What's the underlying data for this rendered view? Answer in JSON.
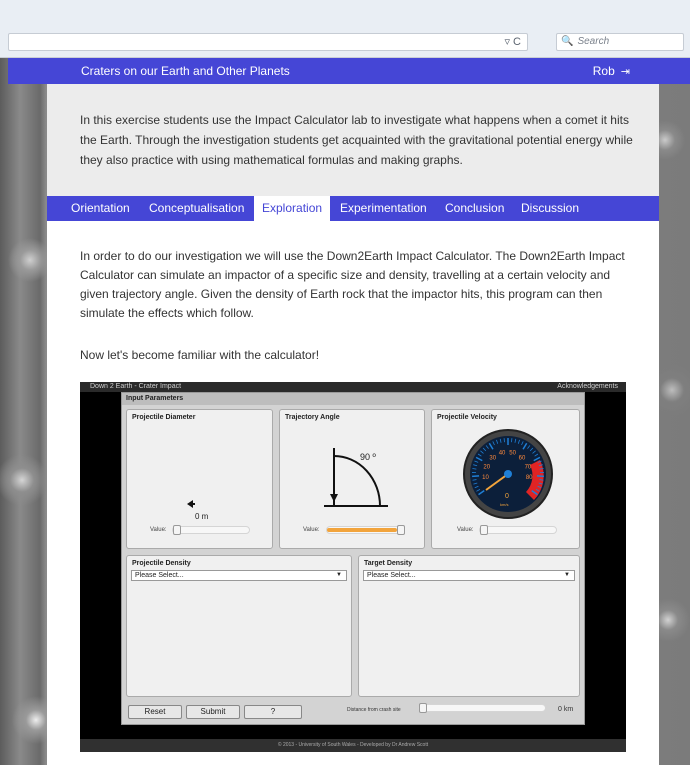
{
  "browser": {
    "search_placeholder": "Search"
  },
  "header": {
    "title": "Craters on our Earth and Other Planets",
    "user": "Rob",
    "logout_glyph": "⇥"
  },
  "intro": {
    "text": "In this exercise students use the Impact Calculator lab to investigate what happens when a comet it hits the Earth. Through the investigation students get acquainted with the gravitational potential energy while they also practice with using mathematical formulas and making graphs."
  },
  "tabs": [
    "Orientation",
    "Conceptualisation",
    "Exploration",
    "Experimentation",
    "Conclusion",
    "Discussion"
  ],
  "active_tab": "Exploration",
  "content": {
    "paragraph": "In order to do our investigation we will use the Down2Earth Impact Calculator. The Down2Earth Impact Calculator can simulate an impactor of a specific size and density, travelling at a certain velocity and given trajectory angle. Given the density of Earth rock that the impactor hits, this program can then simulate the effects which follow.",
    "paragraph2": "Now let's become familiar with the calculator!"
  },
  "simulator": {
    "title": "Down 2 Earth - Crater Impact",
    "acknowledgements": "Acknowledgements",
    "panel_title": "Input Parameters",
    "diameter": {
      "title": "Projectile Diameter",
      "value_label": "Value:",
      "readout": "0 m"
    },
    "angle": {
      "title": "Trajectory Angle",
      "value_label": "Value:",
      "readout": "90 º"
    },
    "velocity": {
      "title": "Projectile Velocity",
      "value_label": "Value:"
    },
    "gauge_ticks": [
      "10",
      "20",
      "30",
      "40",
      "50",
      "60",
      "70",
      "80"
    ],
    "gauge_value": "0",
    "gauge_unit": "km/s",
    "projectile_density": {
      "title": "Projectile Density",
      "selected": "Please Select..."
    },
    "target_density": {
      "title": "Target Density",
      "selected": "Please Select..."
    },
    "buttons": {
      "reset": "Reset",
      "submit": "Submit",
      "help": "?"
    },
    "distance_label": "Distance from crash site",
    "distance_readout": "0 km",
    "footer": "© 2013 - University of South Wales - Developed by Dr Andrew Scott",
    "colors": {
      "slider_fill": "#f2a43c",
      "gauge_red": "#e02424",
      "gauge_blue": "#1f7fd6"
    }
  },
  "colors": {
    "accent": "#4546d6"
  }
}
